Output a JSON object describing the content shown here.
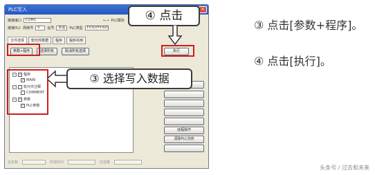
{
  "dialog": {
    "title": "PLC写入",
    "close_label": "×",
    "row1": {
      "label1": "链接接口",
      "value1": "COM1",
      "label2": "←→",
      "value2": "PLC模块"
    },
    "row2": {
      "label1": "链接PLC",
      "value1": "网络号",
      "label2": "0",
      "label3": "站号",
      "label4": "本站",
      "label5": "PLC类型",
      "label6": "FX3U/FX3UC"
    },
    "tabs": [
      "文件选择",
      "软元件数据",
      "程序",
      "程序共用"
    ],
    "sub_tabs": [
      "参数+程序",
      "选择所有",
      "取消所有选择"
    ],
    "execute_label": "执行",
    "right_buttons": [
      "",
      "",
      "",
      "",
      "",
      "远程操作",
      "清除PLC内存",
      ""
    ],
    "tree": [
      {
        "label": "程序",
        "indent": 0,
        "expander": "-"
      },
      {
        "label": "MAIN",
        "indent": 1,
        "checked": true
      },
      {
        "label": "软元件注释",
        "indent": 0,
        "expander": "-"
      },
      {
        "label": "COMMENT",
        "indent": 1,
        "checked": false
      },
      {
        "label": "参数",
        "indent": 0,
        "expander": "-"
      },
      {
        "label": "PLC参数",
        "indent": 1,
        "checked": true
      }
    ],
    "status_labels": [
      "总步数",
      "所需时间",
      "空容量"
    ]
  },
  "callouts": {
    "execute_step": "④ 点击",
    "select_step": "③ 选择写入数据"
  },
  "instructions": {
    "step3": "③ 点击[参数+程序]。",
    "step4": "④ 点击[执行]。"
  },
  "watermark": "头条号 / 过去和未来"
}
